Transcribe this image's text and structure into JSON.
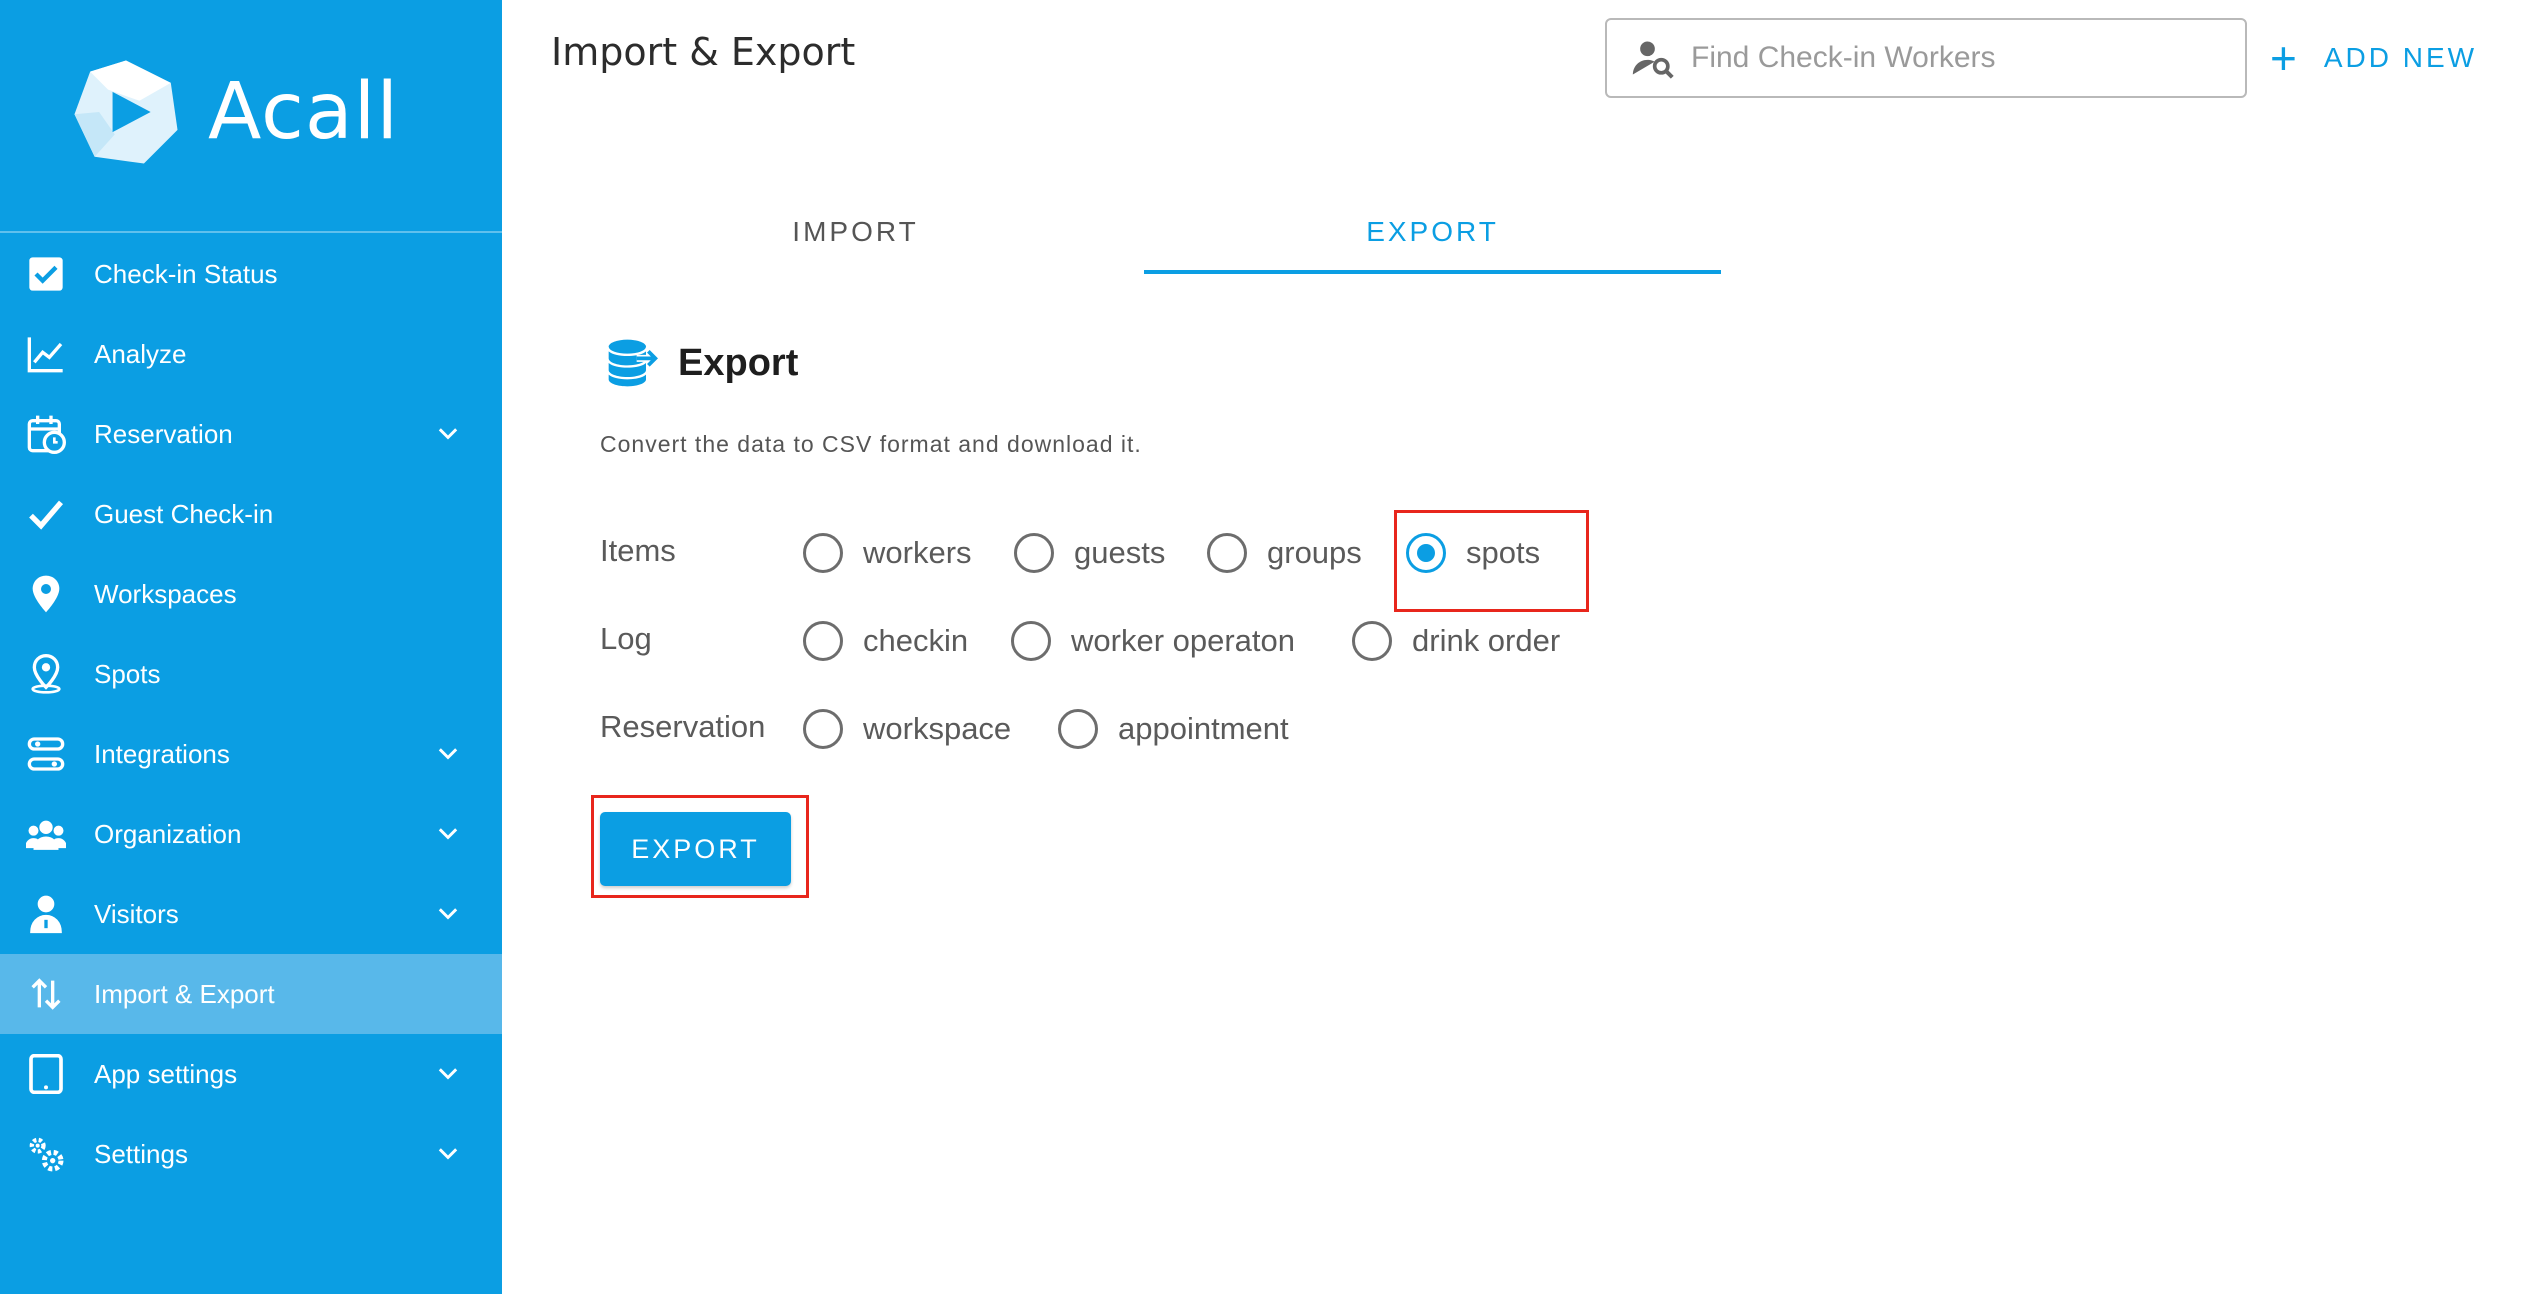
{
  "brand": {
    "name": "Acall"
  },
  "header": {
    "title": "Import & Export",
    "search_placeholder": "Find Check-in Workers",
    "add_new_label": "ADD NEW"
  },
  "sidebar": {
    "items": [
      {
        "label": "Check-in Status",
        "icon": "checkbox-icon",
        "expandable": false,
        "active": false
      },
      {
        "label": "Analyze",
        "icon": "line-chart-icon",
        "expandable": false,
        "active": false
      },
      {
        "label": "Reservation",
        "icon": "calendar-clock-icon",
        "expandable": true,
        "active": false
      },
      {
        "label": "Guest Check-in",
        "icon": "checkmark-icon",
        "expandable": false,
        "active": false
      },
      {
        "label": "Workspaces",
        "icon": "map-pin-icon",
        "expandable": false,
        "active": false
      },
      {
        "label": "Spots",
        "icon": "person-pin-icon",
        "expandable": false,
        "active": false
      },
      {
        "label": "Integrations",
        "icon": "integrations-icon",
        "expandable": true,
        "active": false
      },
      {
        "label": "Organization",
        "icon": "people-group-icon",
        "expandable": true,
        "active": false
      },
      {
        "label": "Visitors",
        "icon": "visitor-icon",
        "expandable": true,
        "active": false
      },
      {
        "label": "Import & Export",
        "icon": "import-export-arrows-icon",
        "expandable": false,
        "active": true
      },
      {
        "label": "App settings",
        "icon": "tablet-icon",
        "expandable": true,
        "active": false
      },
      {
        "label": "Settings",
        "icon": "gears-icon",
        "expandable": true,
        "active": false
      }
    ]
  },
  "tabs": [
    {
      "label": "IMPORT",
      "active": false
    },
    {
      "label": "EXPORT",
      "active": true
    }
  ],
  "export_section": {
    "title": "Export",
    "description": "Convert the data to CSV format and download it.",
    "rows": [
      {
        "label": "Items",
        "options": [
          "workers",
          "guests",
          "groups",
          "spots"
        ]
      },
      {
        "label": "Log",
        "options": [
          "checkin",
          "worker operaton",
          "drink order"
        ]
      },
      {
        "label": "Reservation",
        "options": [
          "workspace",
          "appointment"
        ]
      }
    ],
    "selected": "spots",
    "button_label": "EXPORT"
  },
  "colors": {
    "primary": "#0b9ee3",
    "sidebar_active": "#58b8ea",
    "highlight": "#e8261c"
  }
}
